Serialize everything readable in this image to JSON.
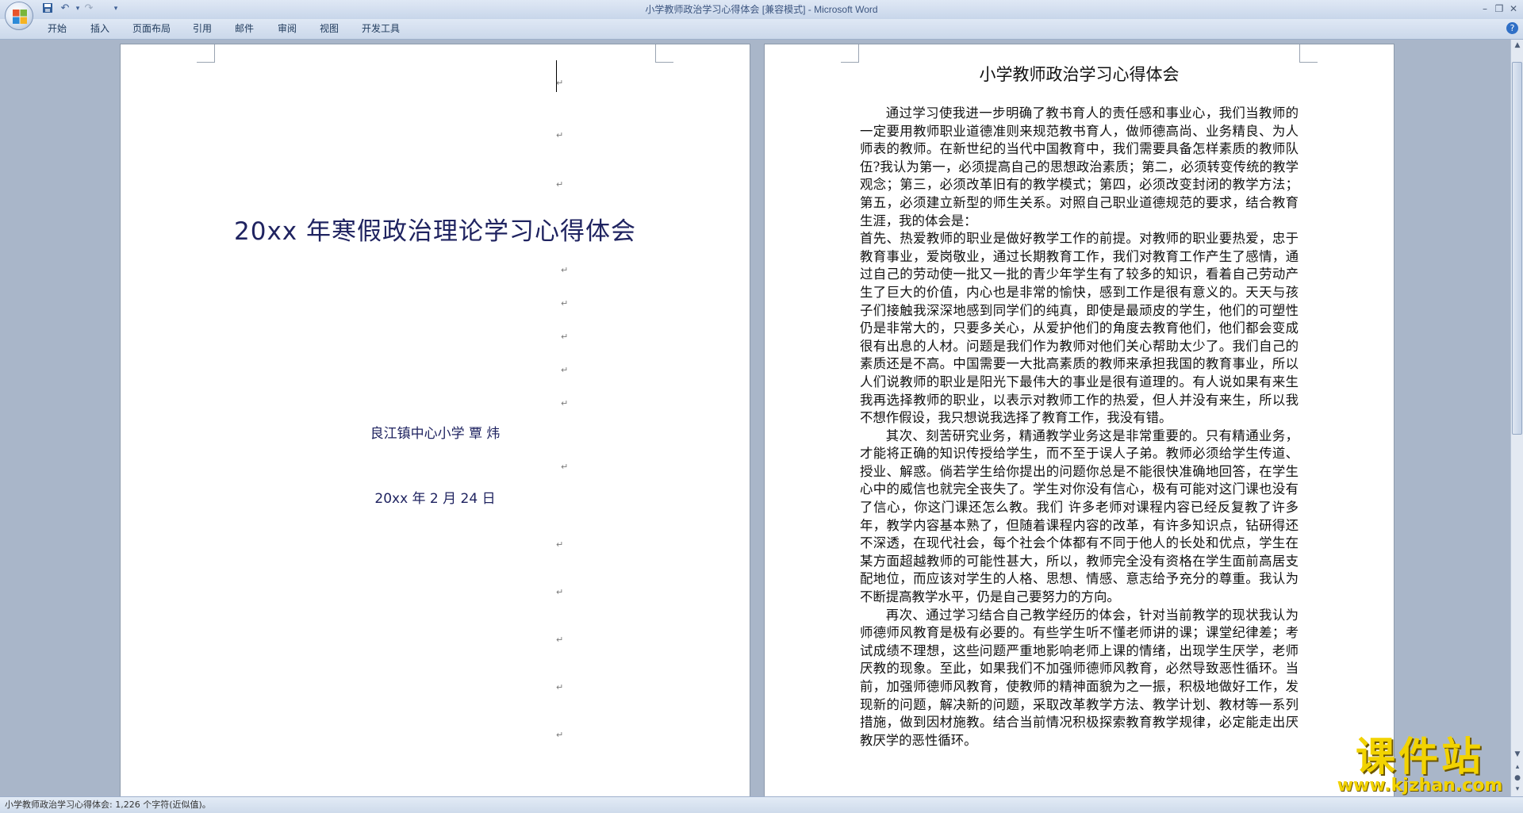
{
  "window": {
    "title": "小学教师政治学习心得体会 [兼容模式] - Microsoft Word"
  },
  "qat": {
    "icons": [
      "save-icon",
      "undo-icon",
      "redo-icon",
      "customize-icon"
    ]
  },
  "ribbon_tabs": [
    "开始",
    "插入",
    "页面布局",
    "引用",
    "邮件",
    "审阅",
    "视图",
    "开发工具"
  ],
  "cover_page": {
    "title": "20xx 年寒假政治理论学习心得体会",
    "author": "良江镇中心小学   覃  炜",
    "date": "20xx 年 2 月 24 日",
    "paragraph_mark": "↵"
  },
  "essay_page": {
    "title": "小学教师政治学习心得体会",
    "paragraphs": [
      "通过学习使我进一步明确了教书育人的责任感和事业心，我们当教师的一定要用教师职业道德准则来规范教书育人，做师德高尚、业务精良、为人师表的教师。在新世纪的当代中国教育中，我们需要具备怎样素质的教师队伍?我认为第一，必须提高自己的思想政治素质；第二，必须转变传统的教学观念；第三，必须改革旧有的教学模式；第四，必须改变封闭的教学方法；第五，必须建立新型的师生关系。对照自己职业道德规范的要求，结合教育生涯，我的体会是：",
      "首先、热爱教师的职业是做好教学工作的前提。对教师的职业要热爱，忠于教育事业，爱岗敬业，通过长期教育工作，我们对教育工作产生了感情，通过自己的劳动使一批又一批的青少年学生有了较多的知识，看着自己劳动产生了巨大的价值，内心也是非常的愉快，感到工作是很有意义的。天天与孩子们接触我深深地感到同学们的纯真，即使是最顽皮的学生，他们的可塑性仍是非常大的，只要多关心，从爱护他们的角度去教育他们，他们都会变成很有出息的人材。问题是我们作为教师对他们关心帮助太少了。我们自己的素质还是不高。中国需要一大批高素质的教师来承担我国的教育事业，所以人们说教师的职业是阳光下最伟大的事业是很有道理的。有人说如果有来生我再选择教师的职业，以表示对教师工作的热爱，但人并没有来生，所以我不想作假设，我只想说我选择了教育工作，我没有错。",
      "其次、刻苦研究业务，精通教学业务这是非常重要的。只有精通业务，才能将正确的知识传授给学生，而不至于误人子弟。教师必须给学生传道、授业、解惑。倘若学生给你提出的问题你总是不能很快准确地回答，在学生心中的威信也就完全丧失了。学生对你没有信心，极有可能对这门课也没有了信心，你这门课还怎么教。我们   许多老师对课程内容已经反复教了许多年，教学内容基本熟了，但随着课程内容的改革，有许多知识点，钻研得还不深透，在现代社会，每个社会个体都有不同于他人的长处和优点，学生在某方面超越教师的可能性甚大，所以，教师完全没有资格在学生面前高居支配地位，而应该对学生的人格、思想、情感、意志给予充分的尊重。我认为不断提高教学水平，仍是自己要努力的方向。",
      "再次、通过学习结合自己教学经历的体会，针对当前教学的现状我认为师德师风教育是极有必要的。有些学生听不懂老师讲的课；课堂纪律差；考试成绩不理想，这些问题严重地影响老师上课的情绪，出现学生厌学，老师厌教的现象。至此，如果我们不加强师德师风教育，必然导致恶性循环。当前，加强师德师风教育，使教师的精神面貌为之一振，积极地做好工作，发现新的问题，解决新的问题，采取改革教学方法、教学计划、教材等一系列措施，做到因材施教。结合当前情况积极探索教育教学规律，必定能走出厌教厌学的恶性循环。"
    ]
  },
  "status_bar": {
    "text": "小学教师政治学习心得体会: 1,226 个字符(近似值)。"
  },
  "watermark": {
    "main": "课件站",
    "url": "www.kjzhan.com"
  },
  "colors": {
    "ribbon": "#dfe8f5",
    "workspace": "#a9b6c9",
    "cover_text": "#1f2360",
    "watermark": "#f2d300"
  }
}
